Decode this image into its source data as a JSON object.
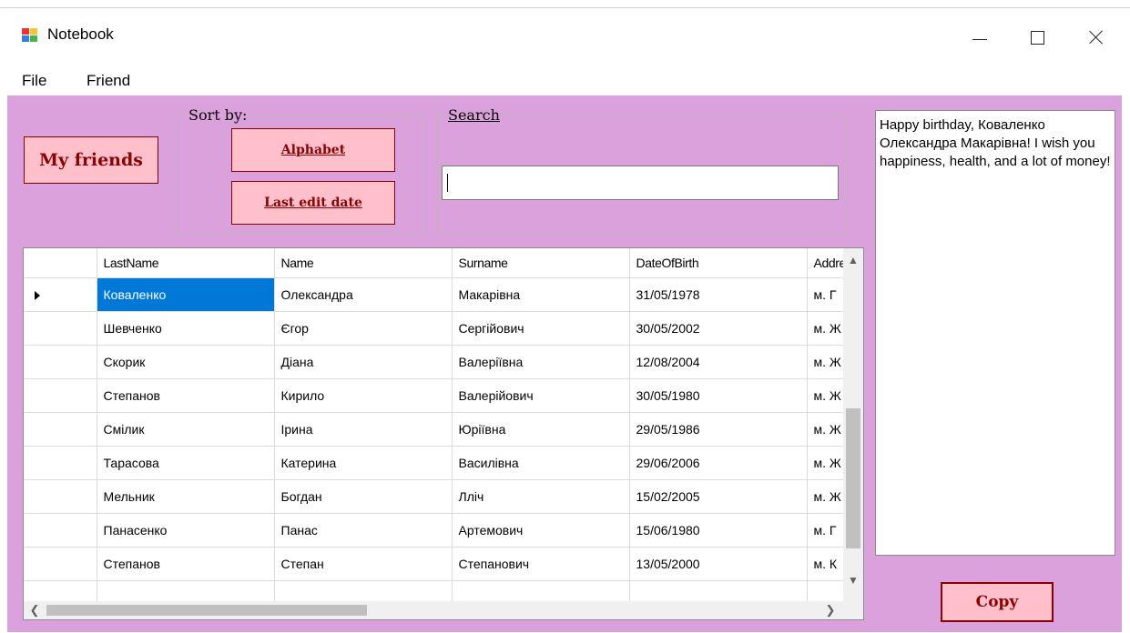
{
  "window": {
    "title": "Notebook",
    "icon": "winforms-app-icon"
  },
  "menu": {
    "file": "File",
    "friend": "Friend"
  },
  "buttons": {
    "my_friends": "My friends",
    "alphabet": "Alphabet",
    "last_edit_date": "Last edit date",
    "copy": "Copy"
  },
  "sort_group": {
    "label": "Sort by:"
  },
  "search_group": {
    "label": "Search",
    "value": "",
    "placeholder": ""
  },
  "message": "Happy birthday, Коваленко Олександра Макарівна! I wish you happiness, health, and a lot of money!",
  "grid": {
    "columns": [
      "LastName",
      "Name",
      "Surname",
      "DateOfBirth",
      "Address"
    ],
    "rows": [
      [
        "Коваленко",
        "Олександра",
        "Макарівна",
        "31/05/1978",
        "м. Г"
      ],
      [
        "Шевченко",
        "Єгор",
        "Сергійович",
        "30/05/2002",
        "м. Ж"
      ],
      [
        "Скорик",
        "Діана",
        "Валеріївна",
        "12/08/2004",
        "м. Ж"
      ],
      [
        "Степанов",
        "Кирило",
        "Валерійович",
        "30/05/1980",
        "м. Ж"
      ],
      [
        "Смілик",
        "Ірина",
        "Юріївна",
        "29/05/1986",
        "м. Ж"
      ],
      [
        "Тарасова",
        "Катерина",
        "Василівна",
        "29/06/2006",
        "м. Ж"
      ],
      [
        "Мельник",
        "Богдан",
        "Лліч",
        "15/02/2005",
        "м. Ж"
      ],
      [
        "Панасенко",
        "Панас",
        "Артемович",
        "15/06/1980",
        "м. Г"
      ],
      [
        "Степанов",
        "Степан",
        "Степанович",
        "13/05/2000",
        "м. К"
      ]
    ],
    "selected_row": 0,
    "selected_col": 0
  },
  "colors": {
    "client_background": "#dba1dc",
    "button_fill": "#ffc0cb",
    "button_text": "#8b0000",
    "selection": "#0078d7"
  }
}
